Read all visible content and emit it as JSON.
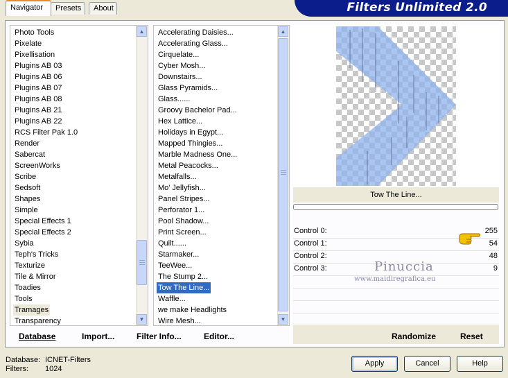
{
  "tabs": [
    "Navigator",
    "Presets",
    "About"
  ],
  "window_title": "Filters Unlimited 2.0",
  "categories": [
    "Photo Tools",
    "Pixelate",
    "Pixellisation",
    "Plugins AB 03",
    "Plugins AB 06",
    "Plugins AB 07",
    "Plugins AB 08",
    "Plugins AB 21",
    "Plugins AB 22",
    "RCS Filter Pak 1.0",
    "Render",
    "Sabercat",
    "ScreenWorks",
    "Scribe",
    "Sedsoft",
    "Shapes",
    "Simple",
    "Special Effects 1",
    "Special Effects 2",
    "Sybia",
    "Teph's Tricks",
    "Texturize",
    "Tile & Mirror",
    "Toadies",
    "Tools",
    "Tramages",
    "Transparency"
  ],
  "selected_category": "Tramages",
  "filters": [
    "Accelerating Daisies...",
    "Accelerating Glass...",
    "Cirquelate...",
    "Cyber Mosh...",
    "Downstairs...",
    "Glass Pyramids...",
    "Glass......",
    "Groovy Bachelor Pad...",
    "Hex Lattice...",
    "Holidays in Egypt...",
    "Mapped Thingies...",
    "Marble Madness One...",
    "Metal Peacocks...",
    "Metalfalls...",
    "Mo' Jellyfish...",
    "Panel Stripes...",
    "Perforator 1...",
    "Pool Shadow...",
    "Print Screen...",
    "Quilt......",
    "Starmaker...",
    "TeeWee...",
    "The Stump 2...",
    "Tow The Line...",
    "Waffle...",
    "we make Headlights",
    "Wire Mesh..."
  ],
  "selected_filter": "Tow The Line...",
  "filter_title": "Tow The Line...",
  "controls": [
    {
      "label": "Control 0:",
      "value": "255"
    },
    {
      "label": "Control 1:",
      "value": "54"
    },
    {
      "label": "Control 2:",
      "value": "48"
    },
    {
      "label": "Control 3:",
      "value": "9"
    }
  ],
  "toolbar": {
    "database": "Database",
    "import": "Import...",
    "filter_info": "Filter Info...",
    "editor": "Editor...",
    "randomize": "Randomize",
    "reset": "Reset"
  },
  "status": {
    "database_label": "Database:",
    "database_value": "ICNET-Filters",
    "filters_label": "Filters:",
    "filters_value": "1024"
  },
  "buttons": {
    "apply": "Apply",
    "cancel": "Cancel",
    "help": "Help"
  },
  "watermark": {
    "name": "Pinuccia",
    "url": "www.maidiregrafica.eu"
  },
  "icons": [
    "scroll-up-arrow-icon",
    "scroll-down-arrow-icon",
    "pointing-hand-icon"
  ]
}
